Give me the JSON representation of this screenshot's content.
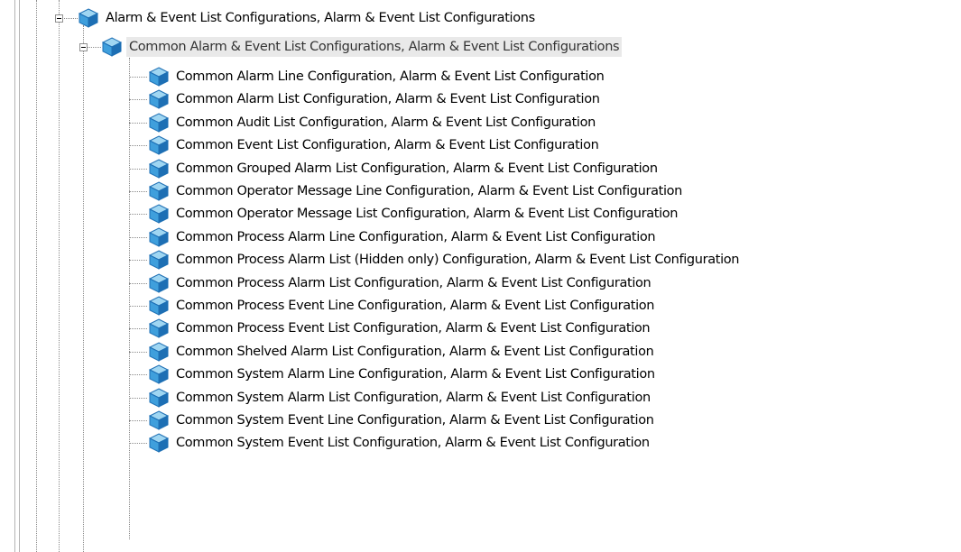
{
  "tree": {
    "root": {
      "label": "Alarm & Event List Configurations, Alarm & Event List Configurations",
      "expanded": true,
      "icon": "cube-icon"
    },
    "group": {
      "label": "Common Alarm & Event List Configurations, Alarm & Event List Configurations",
      "expanded": true,
      "selected": true,
      "icon": "cube-icon"
    },
    "items": [
      {
        "label": "Common Alarm Line Configuration, Alarm & Event List Configuration"
      },
      {
        "label": "Common Alarm List Configuration, Alarm & Event List Configuration"
      },
      {
        "label": "Common Audit List Configuration, Alarm & Event List Configuration"
      },
      {
        "label": "Common Event List Configuration, Alarm & Event List Configuration"
      },
      {
        "label": "Common Grouped Alarm List Configuration, Alarm & Event List Configuration"
      },
      {
        "label": "Common Operator Message Line Configuration, Alarm & Event List Configuration"
      },
      {
        "label": "Common Operator Message List Configuration, Alarm & Event List Configuration"
      },
      {
        "label": "Common Process Alarm Line Configuration, Alarm & Event List Configuration"
      },
      {
        "label": "Common Process Alarm List (Hidden only) Configuration, Alarm & Event List Configuration"
      },
      {
        "label": "Common Process Alarm List Configuration, Alarm & Event List Configuration"
      },
      {
        "label": "Common Process Event Line Configuration, Alarm & Event List Configuration"
      },
      {
        "label": "Common Process Event List Configuration, Alarm & Event List Configuration"
      },
      {
        "label": "Common Shelved Alarm List Configuration, Alarm & Event List Configuration"
      },
      {
        "label": "Common System Alarm Line Configuration, Alarm & Event List Configuration"
      },
      {
        "label": "Common System Alarm List Configuration, Alarm & Event List Configuration"
      },
      {
        "label": "Common System Event Line Configuration, Alarm & Event List Configuration"
      },
      {
        "label": "Common System Event List Configuration, Alarm & Event List Configuration"
      }
    ],
    "colors": {
      "selection": "#e9e9e9",
      "connector": "#8a8a8a",
      "icon_light": "#9fd6f2",
      "icon_mid": "#3f9fdc",
      "icon_dark": "#1d6fb4"
    }
  }
}
